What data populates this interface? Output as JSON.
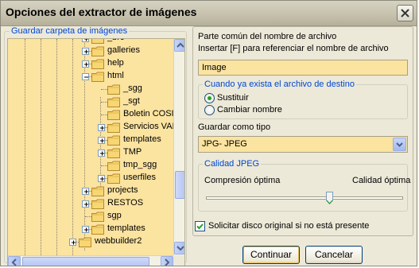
{
  "window": {
    "title": "Opciones del extractor de imágenes"
  },
  "left_group": {
    "label": "Guardar carpeta de imágenes"
  },
  "tree": {
    "items": [
      {
        "label": "_brc",
        "expander": "+"
      },
      {
        "label": "galleries",
        "expander": "+"
      },
      {
        "label": "help",
        "expander": "+"
      },
      {
        "label": "html",
        "expander": "-"
      },
      {
        "label": "_sgg",
        "expander": ""
      },
      {
        "label": "_sgt",
        "expander": ""
      },
      {
        "label": "Boletin COSIT",
        "expander": ""
      },
      {
        "label": "Servicios VAI",
        "expander": "+"
      },
      {
        "label": "templates",
        "expander": "+"
      },
      {
        "label": "TMP",
        "expander": "+"
      },
      {
        "label": "tmp_sgg",
        "expander": ""
      },
      {
        "label": "userfiles",
        "expander": "+"
      },
      {
        "label": "projects",
        "expander": "+"
      },
      {
        "label": "RESTOS",
        "expander": "+"
      },
      {
        "label": "sgp",
        "expander": ""
      },
      {
        "label": "templates",
        "expander": "+"
      },
      {
        "label": "webbuilder2",
        "expander": "+"
      }
    ]
  },
  "name_section": {
    "label1": "Parte común del nombre de archivo",
    "label2": "Insertar [F] para referenciar el nombre de archivo",
    "value": "Image"
  },
  "exists_group": {
    "label": "Cuando ya exista el archivo de destino",
    "option1": "Sustituir",
    "option2": "Cambiar nombre",
    "selected": "Sustituir"
  },
  "type_section": {
    "label": "Guardar como tipo",
    "value": "JPG- JPEG"
  },
  "quality_group": {
    "label": "Calidad JPEG",
    "min_label": "Compresión óptima",
    "max_label": "Calidad óptima",
    "level": 0.63
  },
  "checkbox": {
    "label": "Solicitar disco original si no está presente",
    "checked": true
  },
  "buttons": {
    "ok": "Continuar",
    "cancel": "Cancelar"
  },
  "colors": {
    "field_bg": "#fbe3a0",
    "group_label": "#0046d5",
    "dialog_bg": "#ece9d8"
  }
}
